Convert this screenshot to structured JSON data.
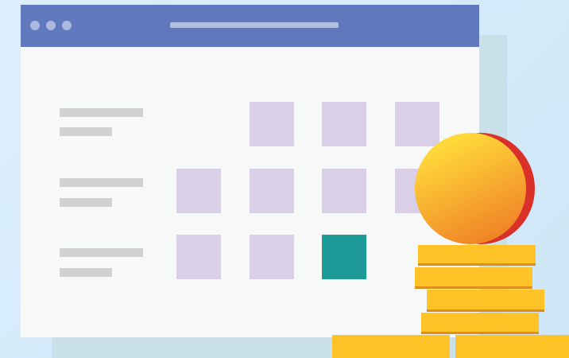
{
  "colors": {
    "background_start": "#dcefff",
    "background_end": "#cde6f5",
    "shadow_panel": "#c9e0e8",
    "window_body": "#f7f9f9",
    "titlebar": "#6078bd",
    "titlebar_dots": "#b9c4e4",
    "address_bar": "#b3bfe3",
    "label_line": "#d1d1d1",
    "cell_empty": "#d9cfe6",
    "cell_selected": "#1e9a99",
    "coin_face_top": "#ffd83a",
    "coin_face_bottom": "#f08426",
    "coin_rim": "#d9302a",
    "stack_coin": "#ffc227",
    "stack_coin_edge": "#e08e1a"
  },
  "window": {
    "titlebar_dots": [
      "window-dot",
      "window-dot",
      "window-dot"
    ]
  },
  "calendar": {
    "rows": [
      {
        "cells": [
          "none",
          "empty",
          "empty",
          "empty"
        ]
      },
      {
        "cells": [
          "empty",
          "empty",
          "empty",
          "empty"
        ]
      },
      {
        "cells": [
          "empty",
          "empty",
          "selected",
          "none"
        ]
      }
    ]
  },
  "illustration": {
    "large_coin": "coin-icon",
    "stack": "coin-stack-icon",
    "stack_layers": 5
  }
}
